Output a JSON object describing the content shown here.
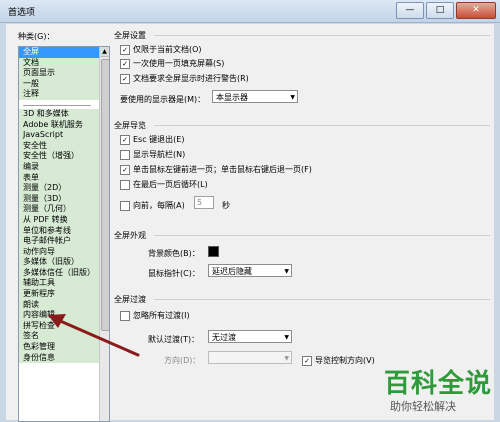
{
  "window": {
    "title": "首选项",
    "buttons": [
      "—",
      "□",
      "✕"
    ]
  },
  "categories": {
    "label": "种类(G)：",
    "top_items": [
      "全屏",
      "文档",
      "页面显示",
      "一般",
      "注释"
    ],
    "items": [
      "3D 和多媒体",
      "Adobe 联机服务",
      "JavaScript",
      "安全性",
      "安全性（增强）",
      "编录",
      "表单",
      "测量（2D）",
      "测量（3D）",
      "测量（几何）",
      "从 PDF 转换",
      "单位和参考线",
      "电子邮件帐户",
      "动作向导",
      "多媒体（旧版）",
      "多媒体信任（旧版）",
      "辅助工具",
      "更新程序",
      "朗读",
      "内容编辑",
      "拼写检查",
      "签名",
      "色彩管理",
      "身份信息"
    ]
  },
  "settings": {
    "title": "全屏设置",
    "opt1": "仅限于当前文档(O)",
    "opt2": "一次使用一页填充屏幕(S)",
    "opt3": "文档要求全屏显示时进行警告(R)",
    "display_label": "要使用的显示器是(M)：",
    "display_value": "本显示器"
  },
  "navigation": {
    "title": "全屏导览",
    "opt1": "Esc 键退出(E)",
    "opt2": "显示导航栏(N)",
    "opt3": "单击鼠标左键前进一页；单击鼠标右键后退一页(F)",
    "opt4": "在最后一页后循环(L)",
    "advance_label": "向前，每隔(A)",
    "advance_value": "5",
    "advance_unit": "秒"
  },
  "appearance": {
    "title": "全屏外观",
    "bg_label": "背景颜色(B)：",
    "pointer_label": "鼠标指针(C)：",
    "pointer_value": "延迟后隐藏"
  },
  "transition": {
    "title": "全屏过渡",
    "ignore_label": "忽略所有过渡(I)",
    "default_label": "默认过渡(T)：",
    "default_value": "无过渡",
    "direction_label": "方向(D)：",
    "navctrl_label": "导览控制方向(V)"
  },
  "watermark": {
    "line1": "百科全说",
    "line2": "助你轻松解决"
  },
  "colors": {
    "accent": "#3399ff",
    "category_bg": "#d6ead4",
    "arrow": "#8b1a1a",
    "watermark": "#2f9a3a"
  }
}
